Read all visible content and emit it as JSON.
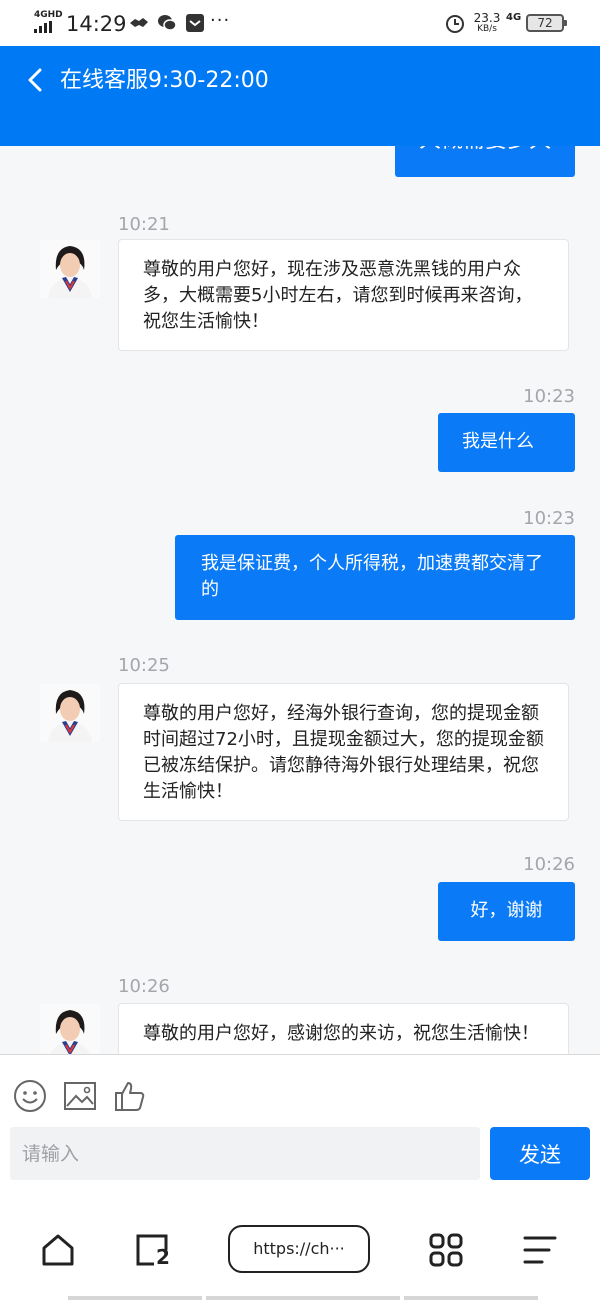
{
  "status_bar": {
    "network": "4GHD",
    "time": "14:29",
    "more": "···",
    "speed": "23.3",
    "speed_unit": "KB/s",
    "signal_type": "4G",
    "battery": "72"
  },
  "header": {
    "back_icon": "chevron-left-icon",
    "title": "在线客服9:30-22:00"
  },
  "chat": {
    "top_partial_text": "大概需要多久",
    "messages": [
      {
        "side": "agent",
        "time": "10:21",
        "text": "尊敬的用户您好，现在涉及恶意洗黑钱的用户众多，大概需要5小时左右，请您到时候再来咨询，祝您生活愉快！"
      },
      {
        "side": "user",
        "time": "10:23",
        "text": "我是什么"
      },
      {
        "side": "user",
        "time": "10:23",
        "text": "我是保证费，个人所得税，加速费都交清了的"
      },
      {
        "side": "agent",
        "time": "10:25",
        "text": "尊敬的用户您好，经海外银行查询，您的提现金额时间超过72小时，且提现金额过大，您的提现金额已被冻结保护。请您静待海外银行处理结果，祝您生活愉快！"
      },
      {
        "side": "user",
        "time": "10:26",
        "text": "好，谢谢"
      },
      {
        "side": "agent",
        "time": "10:26",
        "text": "尊敬的用户您好，感谢您的来访，祝您生活愉快！"
      }
    ]
  },
  "composer": {
    "icons": [
      "emoji-icon",
      "image-icon",
      "thumbs-up-icon"
    ],
    "placeholder": "请输入",
    "send_label": "发送"
  },
  "browser": {
    "url": "https://ch···",
    "tab_count": "2",
    "icons": [
      "home-icon",
      "tabs-icon",
      "apps-icon",
      "menu-icon"
    ]
  },
  "colors": {
    "brand": "#0079f5",
    "user_bubble": "#0a7af6",
    "chat_bg": "#f6f7f9"
  }
}
